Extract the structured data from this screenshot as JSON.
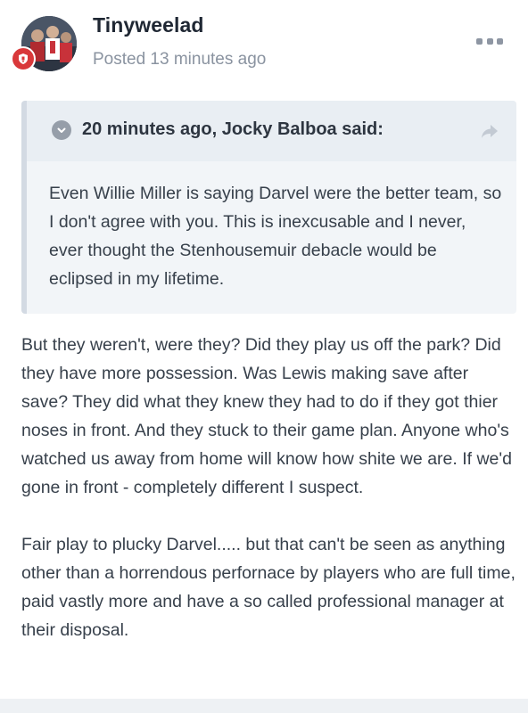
{
  "post": {
    "author": "Tinyweelad",
    "posted": "Posted 13 minutes ago",
    "avatar_icon": "user-avatar-photo",
    "badge_icon": "rank-badge-icon",
    "more_icon": "more-options-icon"
  },
  "quote": {
    "citation": "20 minutes ago, Jocky Balboa said:",
    "toggle_icon": "chevron-down-icon",
    "share_icon": "share-arrow-icon",
    "body": "Even Willie Miller is saying Darvel were the better team, so I don't agree with you. This is inexcusable and I never, ever thought the Stenhousemuir debacle would be eclipsed in my lifetime."
  },
  "content": {
    "paragraphs": [
      "But they weren't, were they? Did they play us off the park? Did they have more possession. Was Lewis making save after save? They did what they knew they had to do if they got thier noses in front. And they stuck to their game plan. Anyone who's watched us away from home will know how shite we are. If we'd gone in front - completely different I suspect.",
      "Fair play to plucky Darvel..... but that can't be seen as anything other than a horrendous perfornace by players who are full time, paid vastly more and have a so called professional manager at their disposal."
    ]
  },
  "colors": {
    "badge": "#d9383a",
    "quote_background": "#f2f5f8",
    "quote_header": "#e9eef3",
    "quote_border": "#d3dae3"
  }
}
